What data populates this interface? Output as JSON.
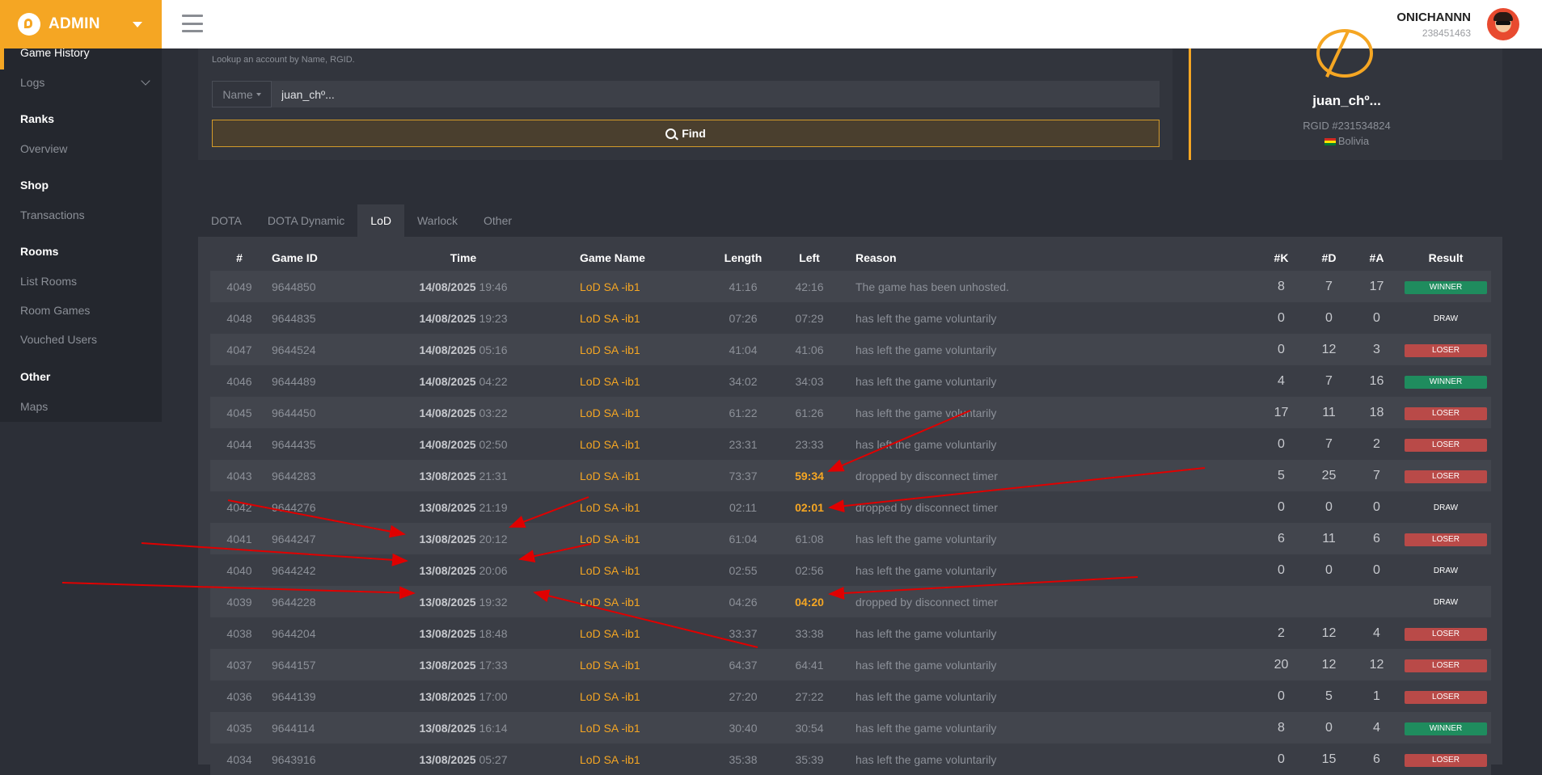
{
  "brand": {
    "title": "ADMIN"
  },
  "user": {
    "name": "ONICHANNN",
    "id": "238451463"
  },
  "sidebar": {
    "items": [
      {
        "label": "Game History"
      },
      {
        "label": "Logs"
      }
    ],
    "sections": [
      {
        "heading": "Ranks",
        "items": [
          "Overview"
        ]
      },
      {
        "heading": "Shop",
        "items": [
          "Transactions"
        ]
      },
      {
        "heading": "Rooms",
        "items": [
          "List Rooms",
          "Room Games",
          "Vouched Users"
        ]
      },
      {
        "heading": "Other",
        "items": [
          "Maps"
        ]
      }
    ]
  },
  "search": {
    "hint": "Lookup an account by Name, RGID.",
    "select_value": "Name",
    "value": "juan_chº...",
    "find_label": "Find"
  },
  "profile": {
    "name": "juan_chº...",
    "rgid": "RGID #231534824",
    "country": "Bolivia"
  },
  "tabs": [
    "DOTA",
    "DOTA Dynamic",
    "LoD",
    "Warlock",
    "Other"
  ],
  "active_tab": "LoD",
  "table": {
    "headers": [
      "#",
      "Game ID",
      "Time",
      "Game Name",
      "Length",
      "Left",
      "Reason",
      "#K",
      "#D",
      "#A",
      "Result"
    ],
    "rows": [
      {
        "num": "4049",
        "gid": "9644850",
        "date": "14/08/2025",
        "clock": "19:46",
        "name": "LoD SA -ib1",
        "len": "41:16",
        "left": "42:16",
        "left_hi": false,
        "reason": "The game has been unhosted.",
        "k": "8",
        "d": "7",
        "a": "17",
        "result": "WINNER"
      },
      {
        "num": "4048",
        "gid": "9644835",
        "date": "14/08/2025",
        "clock": "19:23",
        "name": "LoD SA -ib1",
        "len": "07:26",
        "left": "07:29",
        "left_hi": false,
        "reason": "has left the game voluntarily",
        "k": "0",
        "d": "0",
        "a": "0",
        "result": "DRAW"
      },
      {
        "num": "4047",
        "gid": "9644524",
        "date": "14/08/2025",
        "clock": "05:16",
        "name": "LoD SA -ib1",
        "len": "41:04",
        "left": "41:06",
        "left_hi": false,
        "reason": "has left the game voluntarily",
        "k": "0",
        "d": "12",
        "a": "3",
        "result": "LOSER"
      },
      {
        "num": "4046",
        "gid": "9644489",
        "date": "14/08/2025",
        "clock": "04:22",
        "name": "LoD SA -ib1",
        "len": "34:02",
        "left": "34:03",
        "left_hi": false,
        "reason": "has left the game voluntarily",
        "k": "4",
        "d": "7",
        "a": "16",
        "result": "WINNER"
      },
      {
        "num": "4045",
        "gid": "9644450",
        "date": "14/08/2025",
        "clock": "03:22",
        "name": "LoD SA -ib1",
        "len": "61:22",
        "left": "61:26",
        "left_hi": false,
        "reason": "has left the game voluntarily",
        "k": "17",
        "d": "11",
        "a": "18",
        "result": "LOSER"
      },
      {
        "num": "4044",
        "gid": "9644435",
        "date": "14/08/2025",
        "clock": "02:50",
        "name": "LoD SA -ib1",
        "len": "23:31",
        "left": "23:33",
        "left_hi": false,
        "reason": "has left the game voluntarily",
        "k": "0",
        "d": "7",
        "a": "2",
        "result": "LOSER"
      },
      {
        "num": "4043",
        "gid": "9644283",
        "date": "13/08/2025",
        "clock": "21:31",
        "name": "LoD SA -ib1",
        "len": "73:37",
        "left": "59:34",
        "left_hi": true,
        "reason": "dropped by disconnect timer",
        "k": "5",
        "d": "25",
        "a": "7",
        "result": "LOSER"
      },
      {
        "num": "4042",
        "gid": "9644276",
        "date": "13/08/2025",
        "clock": "21:19",
        "name": "LoD SA -ib1",
        "len": "02:11",
        "left": "02:01",
        "left_hi": true,
        "reason": "dropped by disconnect timer",
        "k": "0",
        "d": "0",
        "a": "0",
        "result": "DRAW"
      },
      {
        "num": "4041",
        "gid": "9644247",
        "date": "13/08/2025",
        "clock": "20:12",
        "name": "LoD SA -ib1",
        "len": "61:04",
        "left": "61:08",
        "left_hi": false,
        "reason": "has left the game voluntarily",
        "k": "6",
        "d": "11",
        "a": "6",
        "result": "LOSER"
      },
      {
        "num": "4040",
        "gid": "9644242",
        "date": "13/08/2025",
        "clock": "20:06",
        "name": "LoD SA -ib1",
        "len": "02:55",
        "left": "02:56",
        "left_hi": false,
        "reason": "has left the game voluntarily",
        "k": "0",
        "d": "0",
        "a": "0",
        "result": "DRAW"
      },
      {
        "num": "4039",
        "gid": "9644228",
        "date": "13/08/2025",
        "clock": "19:32",
        "name": "LoD SA -ib1",
        "len": "04:26",
        "left": "04:20",
        "left_hi": true,
        "reason": "dropped by disconnect timer",
        "k": "",
        "d": "",
        "a": "",
        "result": "DRAW"
      },
      {
        "num": "4038",
        "gid": "9644204",
        "date": "13/08/2025",
        "clock": "18:48",
        "name": "LoD SA -ib1",
        "len": "33:37",
        "left": "33:38",
        "left_hi": false,
        "reason": "has left the game voluntarily",
        "k": "2",
        "d": "12",
        "a": "4",
        "result": "LOSER"
      },
      {
        "num": "4037",
        "gid": "9644157",
        "date": "13/08/2025",
        "clock": "17:33",
        "name": "LoD SA -ib1",
        "len": "64:37",
        "left": "64:41",
        "left_hi": false,
        "reason": "has left the game voluntarily",
        "k": "20",
        "d": "12",
        "a": "12",
        "result": "LOSER"
      },
      {
        "num": "4036",
        "gid": "9644139",
        "date": "13/08/2025",
        "clock": "17:00",
        "name": "LoD SA -ib1",
        "len": "27:20",
        "left": "27:22",
        "left_hi": false,
        "reason": "has left the game voluntarily",
        "k": "0",
        "d": "5",
        "a": "1",
        "result": "LOSER"
      },
      {
        "num": "4035",
        "gid": "9644114",
        "date": "13/08/2025",
        "clock": "16:14",
        "name": "LoD SA -ib1",
        "len": "30:40",
        "left": "30:54",
        "left_hi": false,
        "reason": "has left the game voluntarily",
        "k": "8",
        "d": "0",
        "a": "4",
        "result": "WINNER"
      },
      {
        "num": "4034",
        "gid": "9643916",
        "date": "13/08/2025",
        "clock": "05:27",
        "name": "LoD SA -ib1",
        "len": "35:38",
        "left": "35:39",
        "left_hi": false,
        "reason": "has left the game voluntarily",
        "k": "0",
        "d": "15",
        "a": "6",
        "result": "LOSER"
      }
    ]
  },
  "colors": {
    "accent": "#f5a623",
    "winner": "#1f8c5e",
    "loser": "#b94a48",
    "arrow": "#e00000"
  }
}
